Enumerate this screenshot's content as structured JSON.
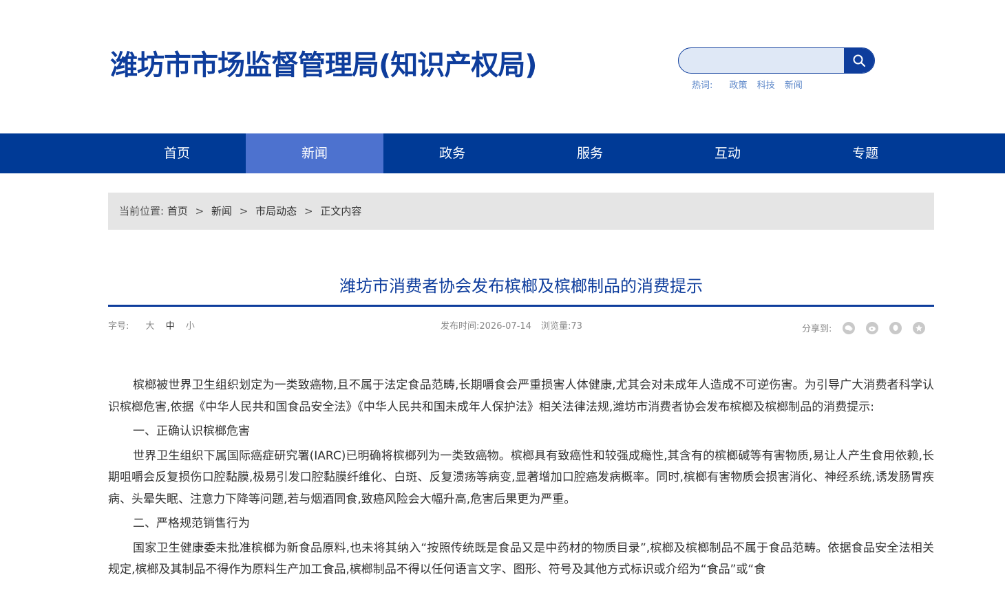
{
  "header": {
    "site_title": "潍坊市市场监督管理局(知识产权局)",
    "search_placeholder": "",
    "hot_label": "热词:",
    "hot_words": [
      "政策",
      "科技",
      "新闻"
    ]
  },
  "nav": {
    "items": [
      "首页",
      "新闻",
      "政务",
      "服务",
      "互动",
      "专题"
    ],
    "active": "新闻"
  },
  "breadcrumb": {
    "label": "当前位置:",
    "items": [
      "首页",
      "新闻",
      "市局动态",
      "正文内容"
    ],
    "separator": ">"
  },
  "article": {
    "title": "潍坊市消费者协会发布槟榔及槟榔制品的消费提示",
    "font_size_label": "字号:",
    "font_sizes": [
      "大",
      "中",
      "小"
    ],
    "publish_label": "发布时间:",
    "publish_date": "2026-07-14",
    "views_label": "浏览量:",
    "views": "73",
    "share_label": "分享到:",
    "share_icons": [
      "wechat-icon",
      "weibo-icon",
      "qq-icon",
      "qzone-icon"
    ],
    "paragraphs": [
      "槟榔被世界卫生组织划定为一类致癌物,且不属于法定食品范畴,长期嚼食会严重损害人体健康,尤其会对未成年人造成不可逆伤害。为引导广大消费者科学认识槟榔危害,依据《中华人民共和国食品安全法》《中华人民共和国未成年人保护法》相关法律法规,潍坊市消费者协会发布槟榔及槟榔制品的消费提示:",
      "一、正确认识槟榔危害",
      "世界卫生组织下属国际癌症研究署(IARC)已明确将槟榔列为一类致癌物。槟榔具有致癌性和较强成瘾性,其含有的槟榔碱等有害物质,易让人产生食用依赖,长期咀嚼会反复损伤口腔黏膜,极易引发口腔黏膜纤维化、白斑、反复溃疡等病变,显著增加口腔癌发病概率。同时,槟榔有害物质会损害消化、神经系统,诱发肠胃疾病、头晕失眠、注意力下降等问题,若与烟酒同食,致癌风险会大幅升高,危害后果更为严重。",
      "二、严格规范销售行为",
      "国家卫生健康委未批准槟榔为新食品原料,也未将其纳入“按照传统既是食品又是中药材的物质目录”,槟榔及槟榔制品不属于食品范畴。依据食品安全法相关规定,槟榔及其制品不得作为原料生产加工食品,槟榔制品不得以任何语言文字、图形、符号及其他方式标识或介绍为“食品”或“食"
    ]
  },
  "colors": {
    "brand_blue": "#0e3d9c",
    "nav_bg": "#003a96",
    "nav_active": "#4d72cf",
    "breadcrumb_bg": "#e5e5e5"
  }
}
